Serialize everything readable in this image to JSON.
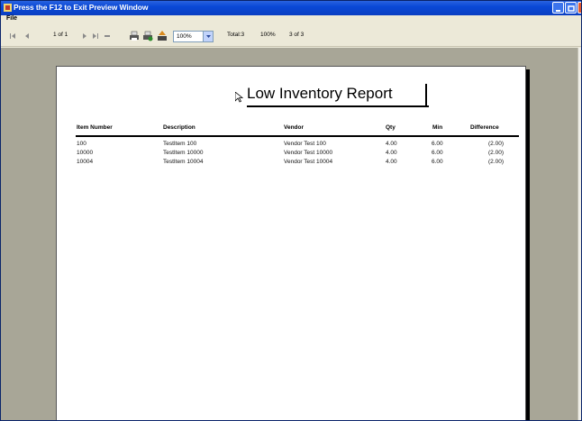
{
  "window": {
    "title": "Press the F12 to Exit Preview Window"
  },
  "menu": {
    "file": "File"
  },
  "toolbar": {
    "page_of": "1 of 1",
    "zoom": "100%",
    "total": "Total:3",
    "percent": "100%",
    "progress": "3 of 3",
    "icons": [
      "first-page-icon",
      "prev-page-icon",
      "next-page-icon",
      "last-page-icon",
      "stop-icon",
      "print-icon",
      "print-setup-icon",
      "export-icon"
    ]
  },
  "report": {
    "title": "Low Inventory Report",
    "columns": [
      "Item Number",
      "Description",
      "Vendor",
      "Qty",
      "Min",
      "Difference"
    ],
    "rows": [
      [
        "100",
        "TestItem 100",
        "Vendor Test 100",
        "4.00",
        "6.00",
        "(2.00)"
      ],
      [
        "10000",
        "TestItem 10000",
        "Vendor Test 10000",
        "4.00",
        "6.00",
        "(2.00)"
      ],
      [
        "10004",
        "TestItem 10004",
        "Vendor Test 10004",
        "4.00",
        "6.00",
        "(2.00)"
      ]
    ]
  }
}
